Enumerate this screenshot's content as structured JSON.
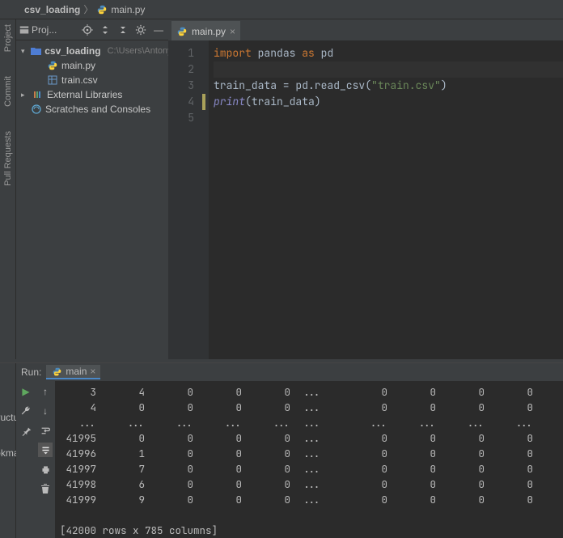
{
  "breadcrumb": {
    "root": "csv_loading",
    "file": "main.py"
  },
  "left_tabs": {
    "project": "Project",
    "commit": "Commit",
    "pull": "Pull Requests"
  },
  "project_panel": {
    "title": "Proj..."
  },
  "tree": {
    "root": "csv_loading",
    "root_path": "C:\\Users\\Antony G",
    "file_main": "main.py",
    "file_train": "train.csv",
    "ext_lib": "External Libraries",
    "scratches": "Scratches and Consoles"
  },
  "editor": {
    "tab_label": "main.py",
    "line_numbers": [
      "1",
      "2",
      "3",
      "4",
      "5"
    ],
    "code": {
      "l1a": "import",
      "l1b": "pandas",
      "l1c": "as",
      "l1d": "pd",
      "l3a": "train_data = pd.read_csv(",
      "l3b": "\"train.csv\"",
      "l3c": ")",
      "l4a": "print",
      "l4b": "(train_data)"
    }
  },
  "run": {
    "label": "Run:",
    "config": "main",
    "left_tabs": {
      "structure": "Structure",
      "bookmarks": "Bookmarks"
    },
    "output_rows": [
      [
        "3",
        "4",
        "0",
        "0",
        "0",
        "...",
        "0",
        "0",
        "0",
        "0"
      ],
      [
        "4",
        "0",
        "0",
        "0",
        "0",
        "...",
        "0",
        "0",
        "0",
        "0"
      ],
      [
        "...",
        "...",
        "...",
        "...",
        "...",
        "...",
        "...",
        "...",
        "...",
        "..."
      ],
      [
        "41995",
        "0",
        "0",
        "0",
        "0",
        "...",
        "0",
        "0",
        "0",
        "0"
      ],
      [
        "41996",
        "1",
        "0",
        "0",
        "0",
        "...",
        "0",
        "0",
        "0",
        "0"
      ],
      [
        "41997",
        "7",
        "0",
        "0",
        "0",
        "...",
        "0",
        "0",
        "0",
        "0"
      ],
      [
        "41998",
        "6",
        "0",
        "0",
        "0",
        "...",
        "0",
        "0",
        "0",
        "0"
      ],
      [
        "41999",
        "9",
        "0",
        "0",
        "0",
        "...",
        "0",
        "0",
        "0",
        "0"
      ]
    ],
    "summary": "[42000 rows x 785 columns]"
  }
}
